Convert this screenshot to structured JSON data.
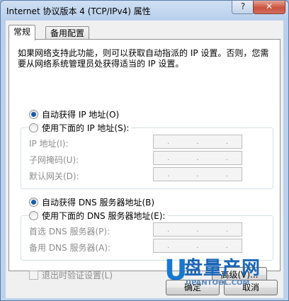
{
  "titlebar": {
    "title": "Internet 协议版本 4 (TCP/IPv4) 属性",
    "help": "?",
    "close": "✕"
  },
  "tabs": [
    "常规",
    "备用配置"
  ],
  "description": "如果网络支持此功能，则可以获取自动指派的 IP 设置。否则，您需要从网络系统管理员处获得适当的 IP 设置。",
  "ip": {
    "auto_label": "自动获得 IP 地址(O)",
    "manual_label": "使用下面的 IP 地址(S):",
    "auto_selected": true,
    "fields": [
      {
        "label": "IP 地址(I):",
        "value": ". . ."
      },
      {
        "label": "子网掩码(U):",
        "value": ". . ."
      },
      {
        "label": "默认网关(D):",
        "value": ". . ."
      }
    ]
  },
  "dns": {
    "auto_label": "自动获得 DNS 服务器地址(B)",
    "manual_label": "使用下面的 DNS 服务器地址(E):",
    "auto_selected": true,
    "fields": [
      {
        "label": "首选 DNS 服务器(P):",
        "value": ". . ."
      },
      {
        "label": "备用 DNS 服务器(A):",
        "value": ". . ."
      }
    ]
  },
  "validate_label": "退出时验证设置(L)",
  "advanced_label": "高级(V)...",
  "ok_label": "确定",
  "cancel_label": "取消",
  "watermark": {
    "text": "盘量产网",
    "url": "UPANTOOL.COM"
  }
}
